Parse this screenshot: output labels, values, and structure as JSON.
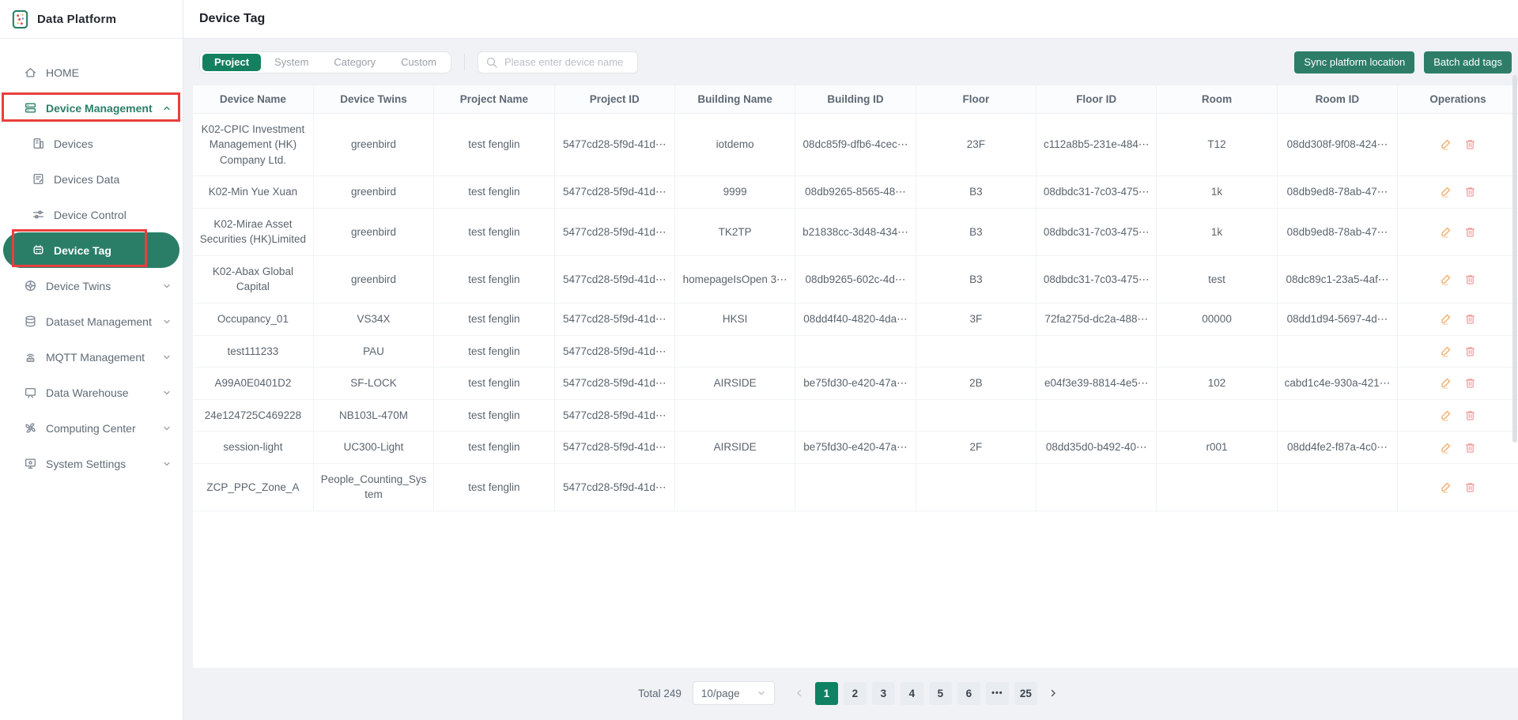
{
  "brand": {
    "name": "Data Platform"
  },
  "page": {
    "title": "Device Tag"
  },
  "sidebar": {
    "items": [
      {
        "label": "HOME",
        "icon": "home",
        "level": 1
      },
      {
        "label": "Device Management",
        "icon": "device-management",
        "level": 1,
        "expanded": true,
        "highlight": true,
        "annotated": true
      },
      {
        "label": "Devices",
        "icon": "devices",
        "level": 2
      },
      {
        "label": "Devices Data",
        "icon": "devices-data",
        "level": 2
      },
      {
        "label": "Device Control",
        "icon": "device-control",
        "level": 2
      },
      {
        "label": "Device Tag",
        "icon": "device-tag",
        "level": 2,
        "active": true,
        "annotated": true
      },
      {
        "label": "Device Twins",
        "icon": "device-twins",
        "level": 1,
        "collapsible": true
      },
      {
        "label": "Dataset Management",
        "icon": "dataset-management",
        "level": 1,
        "collapsible": true
      },
      {
        "label": "MQTT Management",
        "icon": "mqtt-management",
        "level": 1,
        "collapsible": true
      },
      {
        "label": "Data Warehouse",
        "icon": "data-warehouse",
        "level": 1,
        "collapsible": true
      },
      {
        "label": "Computing Center",
        "icon": "computing-center",
        "level": 1,
        "collapsible": true
      },
      {
        "label": "System Settings",
        "icon": "system-settings",
        "level": 1,
        "collapsible": true
      }
    ]
  },
  "toolbar": {
    "tabs": [
      {
        "label": "Project",
        "active": true
      },
      {
        "label": "System"
      },
      {
        "label": "Category"
      },
      {
        "label": "Custom"
      }
    ],
    "search_placeholder": "Please enter device name",
    "sync_button": "Sync platform location",
    "batch_button": "Batch add tags"
  },
  "table": {
    "columns": [
      {
        "label": "Device Name",
        "key": "device_name"
      },
      {
        "label": "Device Twins",
        "key": "device_twins"
      },
      {
        "label": "Project Name",
        "key": "project_name"
      },
      {
        "label": "Project ID",
        "key": "project_id"
      },
      {
        "label": "Building Name",
        "key": "building_name"
      },
      {
        "label": "Building ID",
        "key": "building_id"
      },
      {
        "label": "Floor",
        "key": "floor"
      },
      {
        "label": "Floor ID",
        "key": "floor_id"
      },
      {
        "label": "Room",
        "key": "room"
      },
      {
        "label": "Room ID",
        "key": "room_id"
      },
      {
        "label": "Operations",
        "key": "ops"
      }
    ],
    "rows": [
      {
        "device_name": "K02-CPIC Investment Management (HK) Company Ltd.",
        "device_twins": "greenbird",
        "project_name": "test fenglin",
        "project_id": "5477cd28-5f9d-41d⋯",
        "building_name": "iotdemo",
        "building_id": "08dc85f9-dfb6-4cec⋯",
        "floor": "23F",
        "floor_id": "c112a8b5-231e-484⋯",
        "room": "T12",
        "room_id": "08dd308f-9f08-424⋯"
      },
      {
        "device_name": "K02-Min Yue Xuan",
        "device_twins": "greenbird",
        "project_name": "test fenglin",
        "project_id": "5477cd28-5f9d-41d⋯",
        "building_name": "9999",
        "building_id": "08db9265-8565-48⋯",
        "floor": "B3",
        "floor_id": "08dbdc31-7c03-475⋯",
        "room": "1k",
        "room_id": "08db9ed8-78ab-47⋯"
      },
      {
        "device_name": "K02-Mirae Asset Securities (HK)Limited",
        "device_twins": "greenbird",
        "project_name": "test fenglin",
        "project_id": "5477cd28-5f9d-41d⋯",
        "building_name": "TK2TP",
        "building_id": "b21838cc-3d48-434⋯",
        "floor": "B3",
        "floor_id": "08dbdc31-7c03-475⋯",
        "room": "1k",
        "room_id": "08db9ed8-78ab-47⋯"
      },
      {
        "device_name": "K02-Abax Global Capital",
        "device_twins": "greenbird",
        "project_name": "test fenglin",
        "project_id": "5477cd28-5f9d-41d⋯",
        "building_name": "homepageIsOpen 3⋯",
        "building_id": "08db9265-602c-4d⋯",
        "floor": "B3",
        "floor_id": "08dbdc31-7c03-475⋯",
        "room": "test",
        "room_id": "08dc89c1-23a5-4af⋯"
      },
      {
        "device_name": "Occupancy_01",
        "device_twins": "VS34X",
        "project_name": "test fenglin",
        "project_id": "5477cd28-5f9d-41d⋯",
        "building_name": "HKSI",
        "building_id": "08dd4f40-4820-4da⋯",
        "floor": "3F",
        "floor_id": "72fa275d-dc2a-488⋯",
        "room": "00000",
        "room_id": "08dd1d94-5697-4d⋯"
      },
      {
        "device_name": "test111233",
        "device_twins": "PAU",
        "project_name": "test fenglin",
        "project_id": "5477cd28-5f9d-41d⋯",
        "building_name": "",
        "building_id": "",
        "floor": "",
        "floor_id": "",
        "room": "",
        "room_id": ""
      },
      {
        "device_name": "A99A0E0401D2",
        "device_twins": "SF-LOCK",
        "project_name": "test fenglin",
        "project_id": "5477cd28-5f9d-41d⋯",
        "building_name": "AIRSIDE",
        "building_id": "be75fd30-e420-47a⋯",
        "floor": "2B",
        "floor_id": "e04f3e39-8814-4e5⋯",
        "room": "102",
        "room_id": "cabd1c4e-930a-421⋯"
      },
      {
        "device_name": "24e124725C469228",
        "device_twins": "NB103L-470M",
        "project_name": "test fenglin",
        "project_id": "5477cd28-5f9d-41d⋯",
        "building_name": "",
        "building_id": "",
        "floor": "",
        "floor_id": "",
        "room": "",
        "room_id": ""
      },
      {
        "device_name": "session-light",
        "device_twins": "UC300-Light",
        "project_name": "test fenglin",
        "project_id": "5477cd28-5f9d-41d⋯",
        "building_name": "AIRSIDE",
        "building_id": "be75fd30-e420-47a⋯",
        "floor": "2F",
        "floor_id": "08dd35d0-b492-40⋯",
        "room": "r001",
        "room_id": "08dd4fe2-f87a-4c0⋯"
      },
      {
        "device_name": "ZCP_PPC_Zone_A",
        "device_twins": "People_Counting_System",
        "project_name": "test fenglin",
        "project_id": "5477cd28-5f9d-41d⋯",
        "building_name": "",
        "building_id": "",
        "floor": "",
        "floor_id": "",
        "room": "",
        "room_id": ""
      }
    ]
  },
  "pagination": {
    "total": "Total 249",
    "page_size": "10/page",
    "items": [
      "prev",
      "1",
      "2",
      "3",
      "4",
      "5",
      "6",
      "ellipsis",
      "25",
      "next"
    ],
    "ellipsis_label": "•••",
    "active_page": "1"
  },
  "colors": {
    "accent_green": "#15805f",
    "button_green": "#2e7d68",
    "sidebar_active_green": "#2a7e68",
    "pagination_active_green": "#0e8262",
    "annotation_red": "#e8403d"
  }
}
